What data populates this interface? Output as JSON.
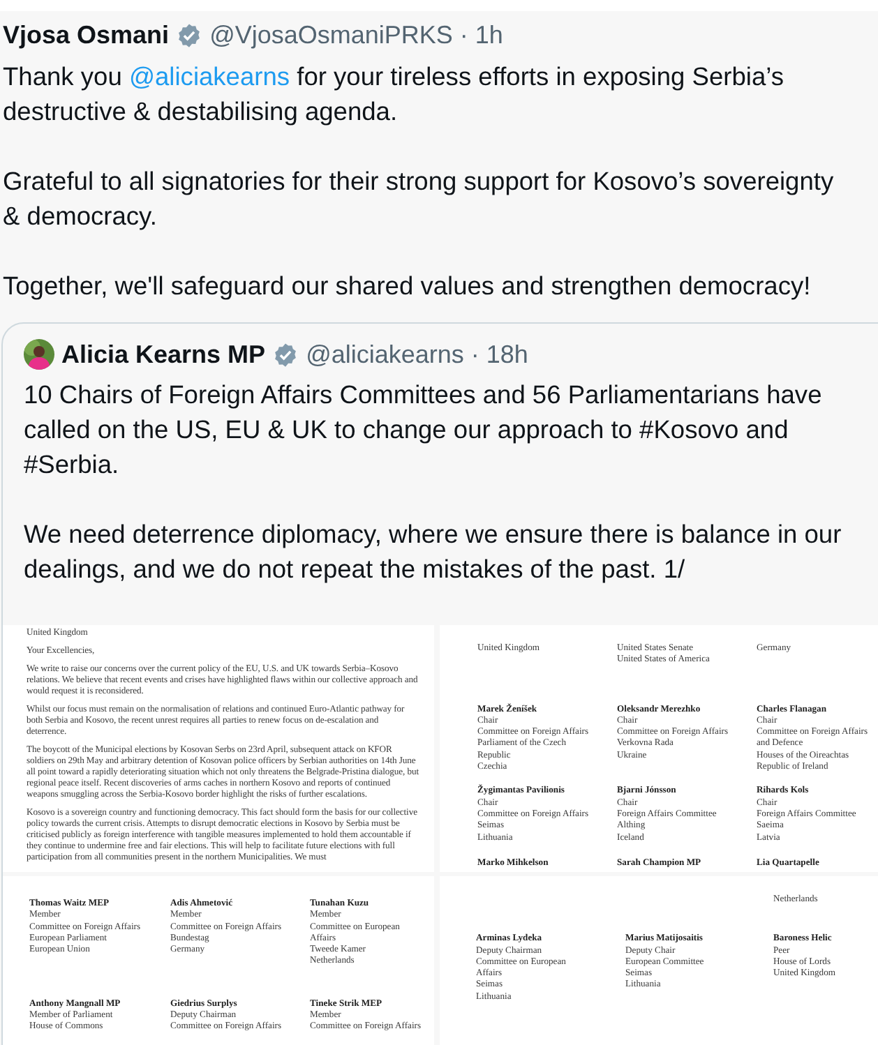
{
  "tweet": {
    "author": "Vjosa Osmani",
    "verified": true,
    "handle": "@VjosaOsmaniPRKS",
    "separator": "·",
    "time": "1h",
    "paragraphs": [
      [
        {
          "text": "Thank you "
        },
        {
          "text": "@aliciakearns",
          "kind": "mention"
        },
        {
          "text": " for your tireless efforts in exposing Serbia’s destructive & destabilising agenda."
        }
      ],
      [
        {
          "text": "Grateful to all signatories for their strong support for Kosovo’s sovereignty & democracy."
        }
      ],
      [
        {
          "text": "Together, we'll safeguard our shared values and strengthen democracy!"
        }
      ]
    ]
  },
  "quote": {
    "author": "Alicia Kearns MP",
    "verified": true,
    "handle": "@aliciakearns",
    "separator": "·",
    "time": "18h",
    "paragraphs": [
      "10 Chairs of Foreign Affairs Committees and 56 Parliamentarians have called on the US, EU & UK to change our approach to #Kosovo and #Serbia.",
      "We need deterrence diplomacy, where we ensure there is balance in our dealings, and we do not repeat the mistakes of the past. 1/"
    ],
    "images": [
      {
        "kind": "letter",
        "paragraphs": [
          "United Kingdom",
          "Your Excellencies,",
          "We write to raise our concerns over the current policy of the EU, U.S. and UK towards Serbia–Kosovo relations. We believe that recent events and crises have highlighted flaws within our collective approach and would request it is reconsidered.",
          "Whilst our focus must remain on the normalisation of relations and continued Euro-Atlantic pathway for both Serbia and Kosovo, the recent unrest requires all parties to renew focus on de-escalation and deterrence.",
          "The boycott of the Municipal elections by Kosovan Serbs on 23rd April, subsequent attack on KFOR soldiers on 29th May and arbitrary detention of Kosovan police officers by Serbian authorities on 14th June all point toward a rapidly deteriorating situation which not only threatens the Belgrade-Pristina dialogue, but regional peace itself. Recent discoveries of arms caches in northern Kosovo and reports of continued weapons smuggling across the Serbia-Kosovo border highlight the risks of further escalations.",
          "Kosovo is a sovereign country and functioning democracy. This fact should form the basis for our collective policy towards the current crisis. Attempts to disrupt democratic elections in Kosovo by Serbia must be criticised publicly as foreign interference with tangible measures implemented to hold them accountable if they continue to undermine free and fair elections. This will help to facilitate future elections with full participation from all communities present in the northern Municipalities. We must"
        ]
      },
      {
        "kind": "signatures",
        "rows": [
          [
            {
              "lines": [
                "United Kingdom"
              ]
            },
            {
              "lines": [
                "United States Senate",
                "United States of America"
              ]
            },
            {
              "lines": [
                "Germany"
              ]
            }
          ],
          [
            {
              "name": "Marek Ženíšek",
              "lines": [
                "Chair",
                "Committee on Foreign Affairs",
                "Parliament of the Czech",
                "Republic",
                "Czechia"
              ]
            },
            {
              "name": "Oleksandr Merezhko",
              "lines": [
                "Chair",
                "Committee on Foreign Affairs",
                "Verkovna Rada",
                "Ukraine"
              ]
            },
            {
              "name": "Charles Flanagan",
              "lines": [
                "Chair",
                "Committee on Foreign Affairs",
                "and Defence",
                "Houses of the Oireachtas",
                "Republic of Ireland"
              ]
            }
          ],
          [
            {
              "name": "Žygimantas Pavilionis",
              "lines": [
                "Chair",
                "Committee on Foreign Affairs",
                "Seimas",
                "Lithuania"
              ]
            },
            {
              "name": "Bjarni Jónsson",
              "lines": [
                "Chair",
                "Foreign Affairs Committee",
                "Althing",
                "Iceland"
              ]
            },
            {
              "name": "Rihards Kols",
              "lines": [
                "Chair",
                "Foreign Affairs Committee",
                "Saeima",
                "Latvia"
              ]
            }
          ],
          [
            {
              "name": "Marko Mihkelson"
            },
            {
              "name": "Sarah Champion MP"
            },
            {
              "name": "Lia Quartapelle"
            }
          ]
        ]
      },
      {
        "kind": "signatures",
        "rows": [
          [
            {
              "name": "Thomas Waitz MEP",
              "lines": [
                "Member",
                "Committee on Foreign Affairs",
                "European Parliament",
                "European Union"
              ]
            },
            {
              "name": "Adis Ahmetović",
              "lines": [
                "Member",
                "Committee on Foreign Affairs",
                "Bundestag",
                "Germany"
              ]
            },
            {
              "name": "Tunahan Kuzu",
              "lines": [
                "Member",
                "Committee on European",
                "Affairs",
                "Tweede Kamer",
                "Netherlands"
              ]
            }
          ],
          [
            {
              "name": "Anthony Mangnall MP",
              "lines": [
                "Member of Parliament",
                "House of Commons"
              ]
            },
            {
              "name": "Giedrius Surplys",
              "lines": [
                "Deputy Chairman",
                "Committee on Foreign Affairs"
              ]
            },
            {
              "name": "Tineke Strik MEP",
              "lines": [
                "Member",
                "Committee on Foreign Affairs"
              ]
            }
          ]
        ]
      },
      {
        "kind": "signatures",
        "rows": [
          [
            {},
            {},
            {
              "lines": [
                "Netherlands"
              ]
            }
          ],
          [
            {
              "name": "Arminas Lydeka",
              "lines": [
                "Deputy Chairman",
                "Committee on European",
                "Affairs",
                "Seimas",
                "Lithuania"
              ]
            },
            {
              "name": "Marius Matijosaitis",
              "lines": [
                "Deputy Chair",
                "European Committee",
                "Seimas",
                "Lithuania"
              ]
            },
            {
              "name": "Baroness Helic",
              "lines": [
                "Peer",
                "House of Lords",
                "United Kingdom"
              ]
            }
          ]
        ]
      }
    ]
  }
}
